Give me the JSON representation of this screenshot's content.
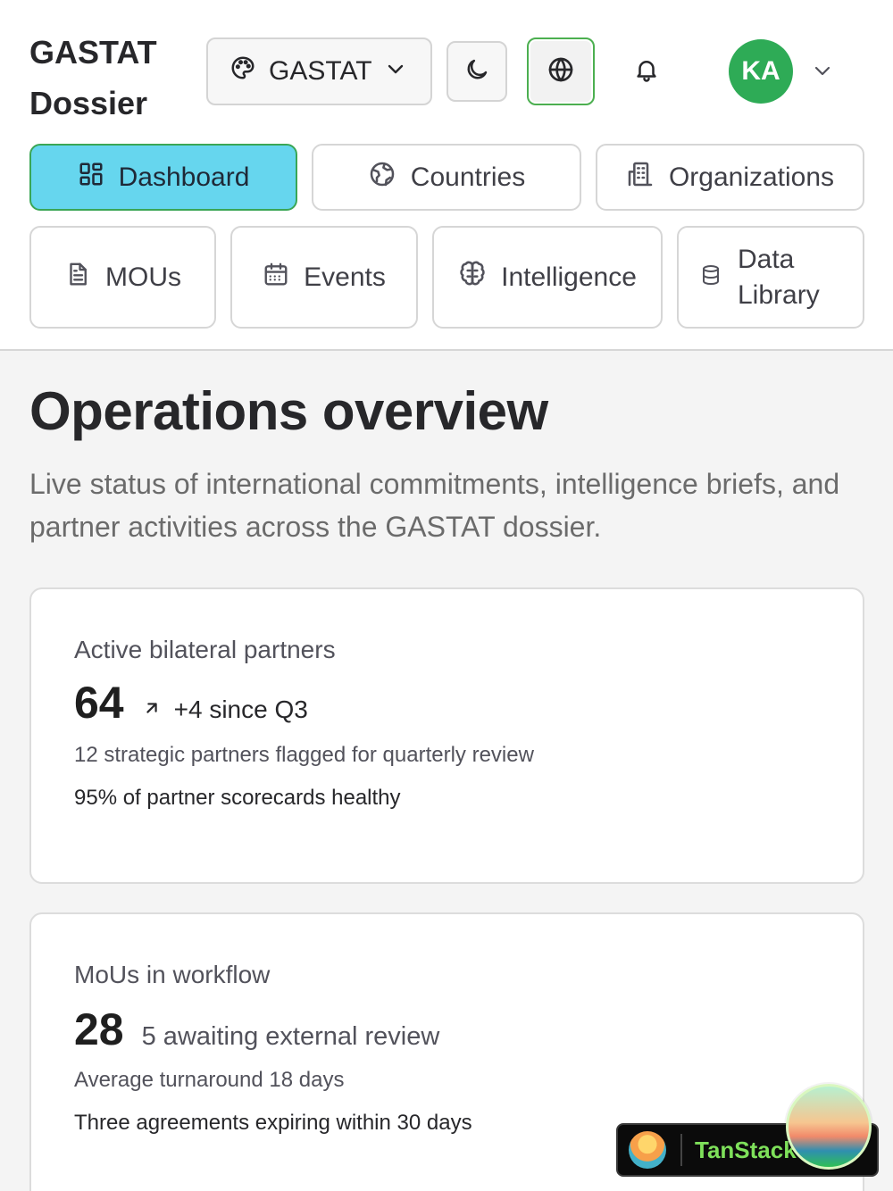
{
  "header": {
    "brand": "GASTAT Dossier",
    "theme_select": {
      "value": "GASTAT"
    },
    "avatar_initials": "KA"
  },
  "nav": {
    "items": [
      {
        "label": "Dashboard",
        "icon": "dashboard-grid-icon",
        "active": true
      },
      {
        "label": "Countries",
        "icon": "globe-map-icon"
      },
      {
        "label": "Organizations",
        "icon": "building-icon"
      },
      {
        "label": "MOUs",
        "icon": "document-icon"
      },
      {
        "label": "Events",
        "icon": "calendar-icon"
      },
      {
        "label": "Intelligence",
        "icon": "brain-icon"
      },
      {
        "label": "Data Library",
        "icon": "database-icon"
      }
    ]
  },
  "main": {
    "title": "Operations overview",
    "subtitle": "Live status of international commitments, intelligence briefs, and partner activities across the GASTAT dossier."
  },
  "cards": [
    {
      "title": "Active bilateral partners",
      "value": "64",
      "trend": "+4 since Q3",
      "lines": [
        "12 strategic partners flagged for quarterly review",
        "95% of partner scorecards healthy"
      ]
    },
    {
      "title": "MoUs in workflow",
      "value": "28",
      "trend": "5 awaiting external review",
      "lines": [
        "Average turnaround 18 days",
        "Three agreements expiring within 30 days"
      ]
    }
  ],
  "devtools": {
    "label": "TanStack"
  },
  "colors": {
    "active_nav": "#66d6ee",
    "avatar": "#2eab56",
    "accent_border": "#3aa655"
  }
}
